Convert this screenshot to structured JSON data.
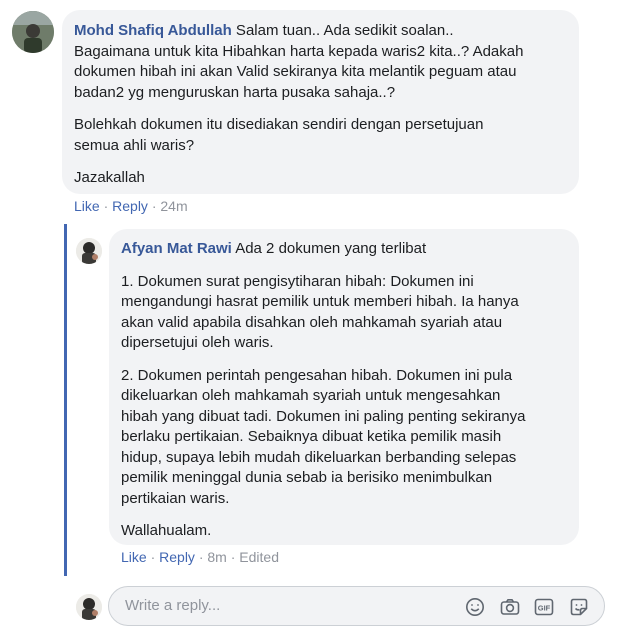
{
  "comment": {
    "author": "Mohd Shafiq Abdullah",
    "first_line": " Salam tuan.. Ada sedikit soalan..",
    "lines": [
      "Bagaimana untuk kita Hibahkan harta kepada waris2 kita..? Adakah",
      "dokumen hibah ini akan Valid sekiranya kita melantik peguam atau",
      "badan2 yg menguruskan harta pusaka sahaja..?"
    ],
    "para2": [
      "Bolehkah dokumen itu disediakan sendiri dengan persetujuan",
      "semua ahli waris?"
    ],
    "para3": "Jazakallah",
    "actions": {
      "like": "Like",
      "reply": "Reply",
      "time": "24m"
    }
  },
  "reply": {
    "author": "Afyan Mat Rawi",
    "first_line": " Ada 2 dokumen yang terlibat",
    "para1": [
      "1. Dokumen surat pengisytiharan hibah: Dokumen ini",
      "mengandungi hasrat pemilik untuk memberi hibah. Ia hanya",
      "akan valid apabila disahkan oleh mahkamah syariah atau",
      "dipersetujui oleh waris."
    ],
    "para2": [
      "2. Dokumen perintah pengesahan hibah. Dokumen ini pula",
      "dikeluarkan oleh mahkamah syariah untuk mengesahkan",
      "hibah yang dibuat tadi. Dokumen ini paling penting sekiranya",
      "berlaku pertikaian. Sebaiknya dibuat ketika pemilik masih",
      "hidup, supaya lebih mudah dikeluarkan berbanding selepas",
      "pemilik meninggal dunia sebab ia berisiko menimbulkan",
      "pertikaian waris."
    ],
    "para3": "Wallahualam.",
    "actions": {
      "like": "Like",
      "reply": "Reply",
      "time": "8m",
      "edited": "Edited"
    }
  },
  "reply_box": {
    "placeholder": "Write a reply...",
    "icons": [
      "emoji-icon",
      "camera-icon",
      "gif-icon",
      "sticker-icon"
    ],
    "gif_label": "GIF"
  },
  "colors": {
    "link": "#385898",
    "action": "#4267b2",
    "muted": "#90949c",
    "bubble": "#f2f3f5"
  }
}
